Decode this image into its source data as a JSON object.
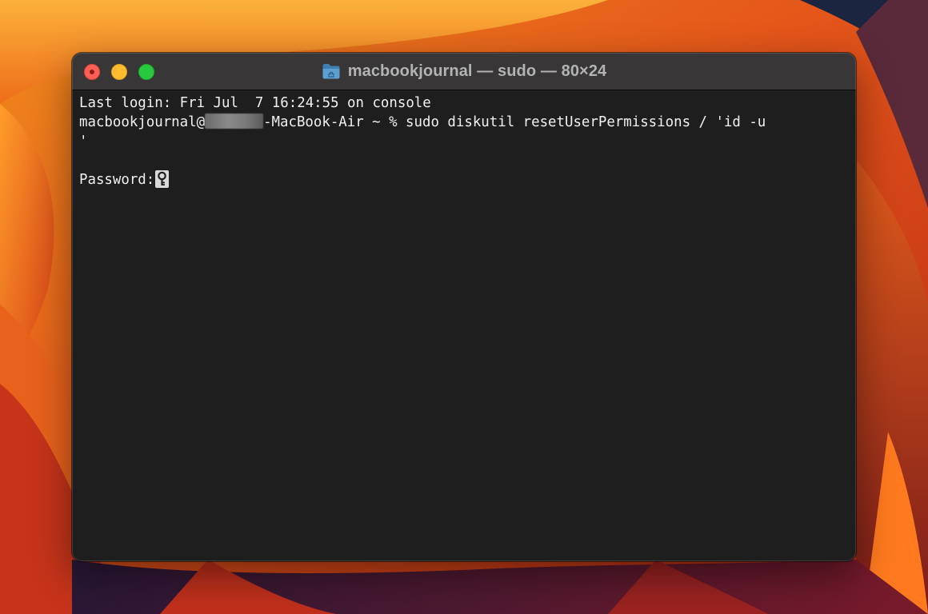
{
  "window": {
    "title": "macbookjournal — sudo — 80×24"
  },
  "controls": {
    "close_color": "#fe5f57",
    "minimize_color": "#febc2e",
    "maximize_color": "#28c840"
  },
  "icons": {
    "title": "folder-icon",
    "cursor": "key-icon"
  },
  "terminal": {
    "line1": "Last login: Fri Jul  7 16:24:55 on console",
    "prompt_user": "macbookjournal@",
    "prompt_host_rest": "-MacBook-Air ~ % sudo diskutil resetUserPermissions / 'id -u",
    "line3": "'",
    "password_prompt": "Password:"
  }
}
